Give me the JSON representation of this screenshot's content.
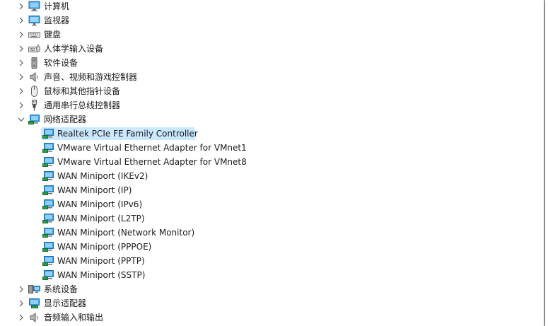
{
  "device_tree": {
    "computer": {
      "label": "计算机",
      "icon": "computer-icon"
    },
    "monitors": {
      "label": "监视器",
      "icon": "monitor-icon"
    },
    "keyboards": {
      "label": "键盘",
      "icon": "keyboard-icon"
    },
    "hid": {
      "label": "人体学输入设备",
      "icon": "hid-icon"
    },
    "software_devices": {
      "label": "软件设备",
      "icon": "software-device-icon"
    },
    "audio_video_game": {
      "label": "声音、视频和游戏控制器",
      "icon": "speaker-icon"
    },
    "mice": {
      "label": "鼠标和其他指针设备",
      "icon": "mouse-icon"
    },
    "usb": {
      "label": "通用串行总线控制器",
      "icon": "usb-icon"
    },
    "network_adapters": {
      "label": "网络适配器",
      "icon": "network-adapter-icon",
      "expanded": true,
      "children": [
        {
          "label": "Realtek PCIe FE Family Controller",
          "selected": true
        },
        {
          "label": "VMware Virtual Ethernet Adapter for VMnet1"
        },
        {
          "label": "VMware Virtual Ethernet Adapter for VMnet8"
        },
        {
          "label": "WAN Miniport (IKEv2)"
        },
        {
          "label": "WAN Miniport (IP)"
        },
        {
          "label": "WAN Miniport (IPv6)"
        },
        {
          "label": "WAN Miniport (L2TP)"
        },
        {
          "label": "WAN Miniport (Network Monitor)"
        },
        {
          "label": "WAN Miniport (PPPOE)"
        },
        {
          "label": "WAN Miniport (PPTP)"
        },
        {
          "label": "WAN Miniport (SSTP)"
        }
      ]
    },
    "system_devices": {
      "label": "系统设备",
      "icon": "system-device-icon"
    },
    "display_adapters": {
      "label": "显示适配器",
      "icon": "display-adapter-icon"
    },
    "audio_io": {
      "label": "音频输入和输出",
      "icon": "speaker-icon"
    }
  },
  "colors": {
    "selection": "#cce8ff",
    "text": "#1a1a1a",
    "chevron": "#5a5a5a",
    "icon_blue": "#2f8fd8"
  }
}
